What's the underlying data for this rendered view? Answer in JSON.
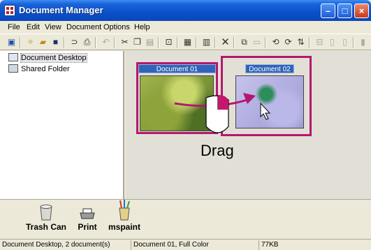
{
  "window": {
    "title": "Document Manager"
  },
  "menu": [
    "File",
    "Edit",
    "View",
    "Document",
    "Options",
    "Help"
  ],
  "tree": {
    "items": [
      {
        "label": "Document Desktop",
        "icon": "desktop-icon"
      },
      {
        "label": "Shared Folder",
        "icon": "shared-folder-icon"
      }
    ]
  },
  "desktop": {
    "documents": [
      {
        "title": "Document 01"
      },
      {
        "title": "Document 02"
      }
    ],
    "drag_label": "Drag"
  },
  "shelf": {
    "items": [
      {
        "label": "Trash Can",
        "icon": "trash-can-icon"
      },
      {
        "label": "Print",
        "icon": "printer-icon"
      },
      {
        "label": "mspaint",
        "icon": "paint-brushes-icon"
      }
    ]
  },
  "status": {
    "location": "Document Desktop, 2 document(s)",
    "selection": "Document 01, Full Color",
    "size": "77KB"
  },
  "colors": {
    "accent": "#b3186e",
    "title_bar": "#0a50cc"
  }
}
